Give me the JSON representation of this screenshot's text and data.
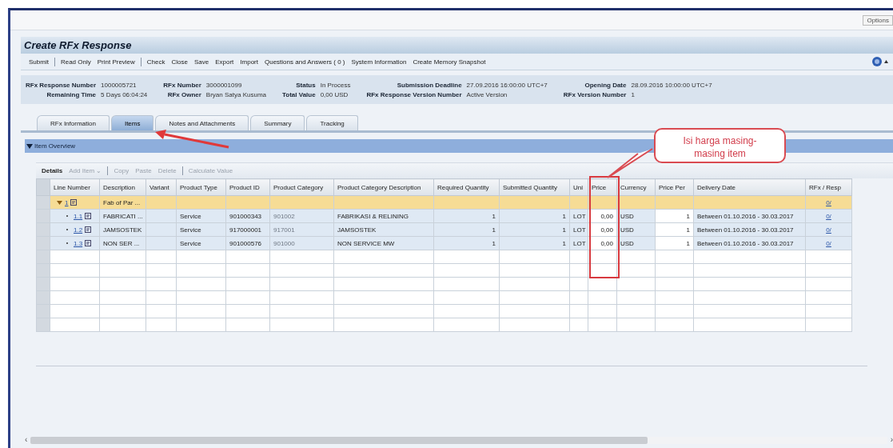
{
  "window": {
    "options_button": "Options"
  },
  "page_title": "Create RFx Response",
  "toolbar": [
    [
      "Submit"
    ],
    [
      "Read Only",
      "Print Preview"
    ],
    [
      "Check",
      "Close",
      "Save",
      "Export",
      "Import",
      "Questions and Answers ( 0 )",
      "System Information",
      "Create Memory Snapshot"
    ]
  ],
  "header_fields": [
    [
      {
        "label": "RFx Response Number",
        "value": "1000005721"
      },
      {
        "label": "RFx Number",
        "value": "3000001099"
      },
      {
        "label": "Status",
        "value": "In Process"
      },
      {
        "label": "Submission Deadline",
        "value": "27.09.2016 16:00:00 UTC+7"
      },
      {
        "label": "Opening Date",
        "value": "28.09.2016 10:00:00 UTC+7"
      }
    ],
    [
      {
        "label": "Remaining Time",
        "value": "5 Days 06:04:24"
      },
      {
        "label": "RFx Owner",
        "value": "Bryan Satya Kusuma"
      },
      {
        "label": "Total Value",
        "value": "0,00 USD"
      },
      {
        "label": "RFx Response Version Number",
        "value": "Active Version"
      },
      {
        "label": "RFx Version Number",
        "value": "1"
      }
    ]
  ],
  "tabs": [
    {
      "label": "RFx Information",
      "selected": false
    },
    {
      "label": "Items",
      "selected": true
    },
    {
      "label": "Notes and Attachments",
      "selected": false
    },
    {
      "label": "Summary",
      "selected": false
    },
    {
      "label": "Tracking",
      "selected": false
    }
  ],
  "section": {
    "title": "Item Overview",
    "expanded": true
  },
  "table_toolbar": [
    [
      {
        "label": "Details",
        "disabled": false
      },
      {
        "label": "Add Item ⌄",
        "disabled": true
      }
    ],
    [
      {
        "label": "Copy",
        "disabled": true
      },
      {
        "label": "Paste",
        "disabled": true
      },
      {
        "label": "Delete",
        "disabled": true
      }
    ],
    [
      {
        "label": "Calculate Value",
        "disabled": true
      }
    ]
  ],
  "table": {
    "columns": [
      "Line Number",
      "Description",
      "Variant",
      "Product Type",
      "Product ID",
      "Product Category",
      "Product Category Description",
      "Required Quantity",
      "Submitted Quantity",
      "Uni",
      "Price",
      "Currency",
      "Price Per",
      "Delivery Date",
      "RFx / Resp"
    ],
    "rows": [
      {
        "line": "1",
        "description": "Fab of Par ...",
        "expanded": true,
        "rfx_response": "0/",
        "children": [
          {
            "line": "1.1",
            "description": "FABRICATI ...",
            "product_type": "Service",
            "product_id": "901000343",
            "product_category": "901002",
            "category_description": "FABRIKASI & RELINING",
            "required_quantity": "1",
            "submitted_quantity": "1",
            "unit": "LOT",
            "price": "0,00",
            "currency": "USD",
            "price_per": "1",
            "delivery_date": "Between 01.10.2016 - 30.03.2017",
            "rfx_response": "0/"
          },
          {
            "line": "1.2",
            "description": "JAMSOSTEK",
            "product_type": "Service",
            "product_id": "917000001",
            "product_category": "917001",
            "category_description": "JAMSOSTEK",
            "required_quantity": "1",
            "submitted_quantity": "1",
            "unit": "LOT",
            "price": "0,00",
            "currency": "USD",
            "price_per": "1",
            "delivery_date": "Between 01.10.2016 - 30.03.2017",
            "rfx_response": "0/"
          },
          {
            "line": "1.3",
            "description": "NON SER ...",
            "product_type": "Service",
            "product_id": "901000576",
            "product_category": "901000",
            "category_description": "NON SERVICE MW",
            "required_quantity": "1",
            "submitted_quantity": "1",
            "unit": "LOT",
            "price": "0,00",
            "currency": "USD",
            "price_per": "1",
            "delivery_date": "Between 01.10.2016 - 30.03.2017",
            "rfx_response": "0/"
          }
        ]
      }
    ]
  },
  "annotations": {
    "callout": "Isi harga masing-masing item"
  },
  "scrollbar": {
    "left_arrow": "‹",
    "right_arrow": "›"
  }
}
